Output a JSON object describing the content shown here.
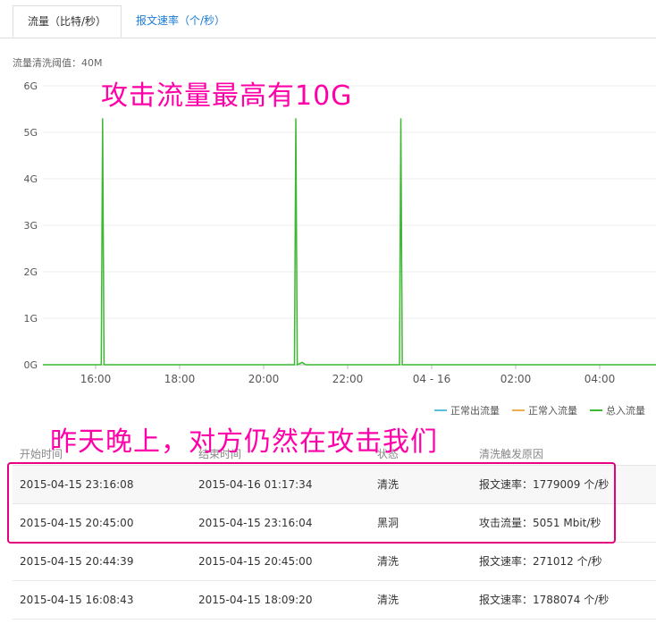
{
  "tabs": [
    {
      "label": "流量（比特/秒）",
      "active": true
    },
    {
      "label": "报文速率（个/秒）",
      "active": false
    }
  ],
  "threshold_text": "流量清洗阈值：40M",
  "annotations": {
    "top": "攻击流量最高有10G",
    "bottom": "昨天晚上，对方仍然在攻击我们"
  },
  "legend": [
    {
      "label": "正常出流量",
      "color": "#5bc0de"
    },
    {
      "label": "正常入流量",
      "color": "#f0ad4e"
    },
    {
      "label": "总入流量",
      "color": "#3cb832"
    }
  ],
  "chart_data": {
    "type": "line",
    "y_ticks": [
      "0G",
      "1G",
      "2G",
      "3G",
      "4G",
      "5G",
      "6G"
    ],
    "x_ticks": [
      "16:00",
      "18:00",
      "20:00",
      "22:00",
      "04 - 16",
      "02:00",
      "04:00"
    ],
    "ylim": [
      0,
      6
    ],
    "series": [
      {
        "name": "总入流量",
        "color": "#3cb832",
        "points": [
          [
            "15:00",
            0
          ],
          [
            "16:08",
            0
          ],
          [
            "16:10",
            5.3
          ],
          [
            "16:12",
            0
          ],
          [
            "20:44",
            0
          ],
          [
            "20:46",
            5.3
          ],
          [
            "20:48",
            0
          ],
          [
            "20:55",
            0.05
          ],
          [
            "21:00",
            0
          ],
          [
            "23:14",
            0
          ],
          [
            "23:16",
            5.3
          ],
          [
            "23:18",
            0
          ],
          [
            "05:30",
            0
          ]
        ]
      }
    ]
  },
  "table": {
    "headers": [
      "开始时间",
      "结束时间",
      "状态",
      "清洗触发原因"
    ],
    "rows": [
      [
        "2015-04-15 23:16:08",
        "2015-04-16 01:17:34",
        "清洗",
        "报文速率：1779009 个/秒"
      ],
      [
        "2015-04-15 20:45:00",
        "2015-04-15 23:16:04",
        "黑洞",
        "攻击流量：5051 Mbit/秒"
      ],
      [
        "2015-04-15 20:44:39",
        "2015-04-15 20:45:00",
        "清洗",
        "报文速率：271012 个/秒"
      ],
      [
        "2015-04-15 16:08:43",
        "2015-04-15 18:09:20",
        "清洗",
        "报文速率：1788074 个/秒"
      ]
    ]
  }
}
